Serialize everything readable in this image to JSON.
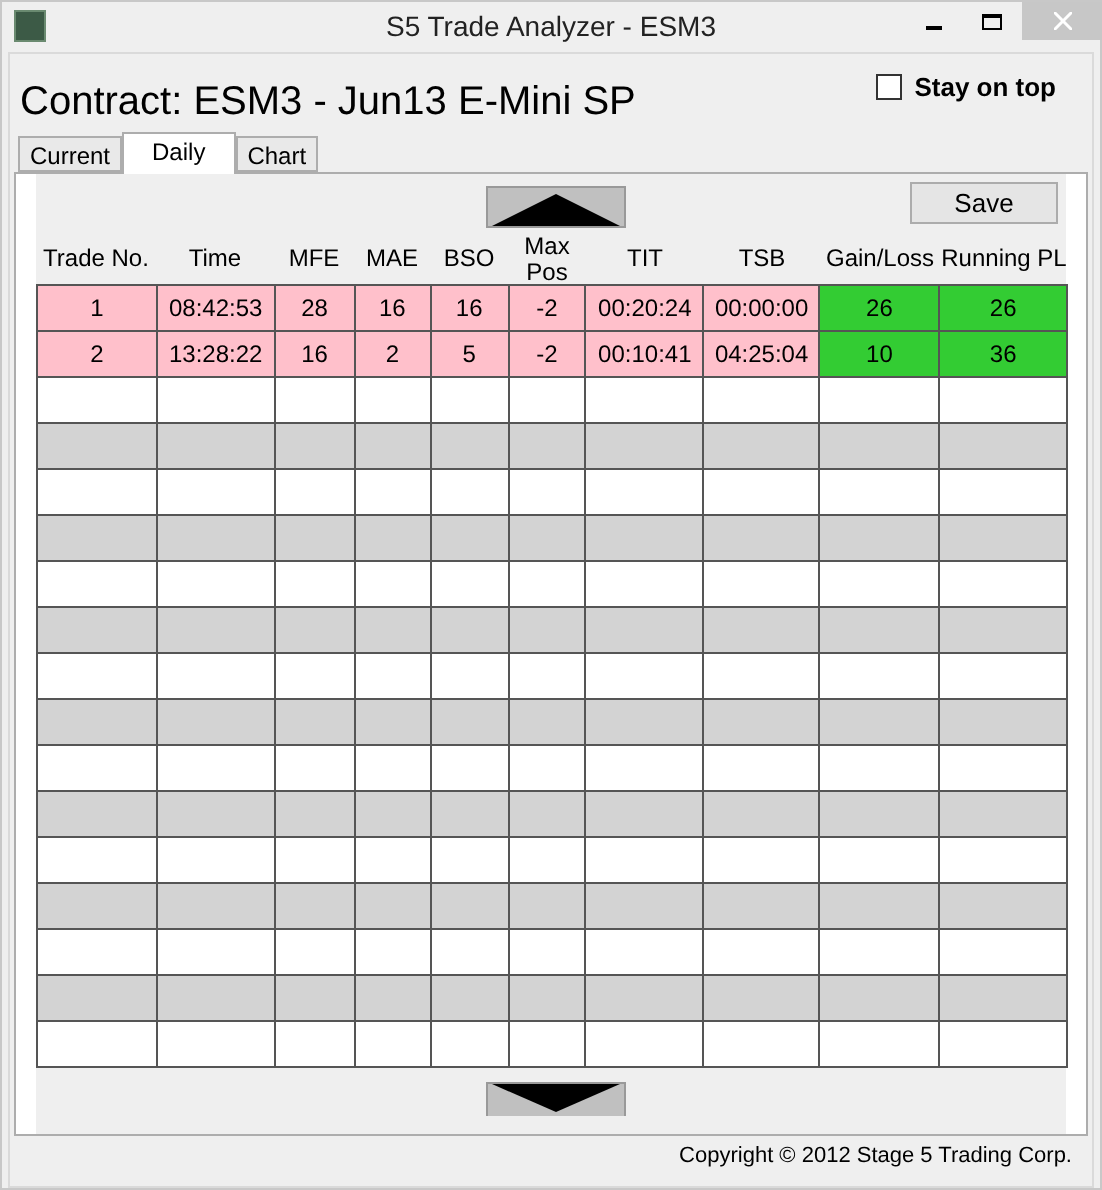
{
  "window": {
    "title": "S5 Trade Analyzer - ESM3"
  },
  "contract": "Contract: ESM3 - Jun13 E-Mini SP",
  "stay_on_top": {
    "label": "Stay on top",
    "checked": false
  },
  "tabs": [
    {
      "label": "Current",
      "selected": false
    },
    {
      "label": "Daily",
      "selected": true
    },
    {
      "label": "Chart",
      "selected": false
    }
  ],
  "save_button": "Save",
  "table": {
    "columns": [
      "Trade No.",
      "Time",
      "MFE",
      "MAE",
      "BSO",
      "Max Pos",
      "TIT",
      "TSB",
      "Gain/Loss",
      "Running PL"
    ],
    "rows": [
      {
        "cells": [
          {
            "text": "1",
            "color": "#ffc0cb"
          },
          {
            "text": "08:42:53",
            "color": "#ffc0cb"
          },
          {
            "text": "28",
            "color": "#ffc0cb"
          },
          {
            "text": "16",
            "color": "#ffc0cb"
          },
          {
            "text": "16",
            "color": "#ffc0cb"
          },
          {
            "text": "-2",
            "color": "#ffc0cb"
          },
          {
            "text": "00:20:24",
            "color": "#ffc0cb"
          },
          {
            "text": "00:00:00",
            "color": "#ffc0cb"
          },
          {
            "text": "26",
            "color": "#33cc33"
          },
          {
            "text": "26",
            "color": "#33cc33"
          }
        ]
      },
      {
        "cells": [
          {
            "text": "2",
            "color": "#ffc0cb"
          },
          {
            "text": "13:28:22",
            "color": "#ffc0cb"
          },
          {
            "text": "16",
            "color": "#ffc0cb"
          },
          {
            "text": "2",
            "color": "#ffc0cb"
          },
          {
            "text": "5",
            "color": "#ffc0cb"
          },
          {
            "text": "-2",
            "color": "#ffc0cb"
          },
          {
            "text": "00:10:41",
            "color": "#ffc0cb"
          },
          {
            "text": "04:25:04",
            "color": "#ffc0cb"
          },
          {
            "text": "10",
            "color": "#33cc33"
          },
          {
            "text": "36",
            "color": "#33cc33"
          }
        ]
      }
    ]
  },
  "status_bar": "Copyright © 2012 Stage 5 Trading Corp."
}
